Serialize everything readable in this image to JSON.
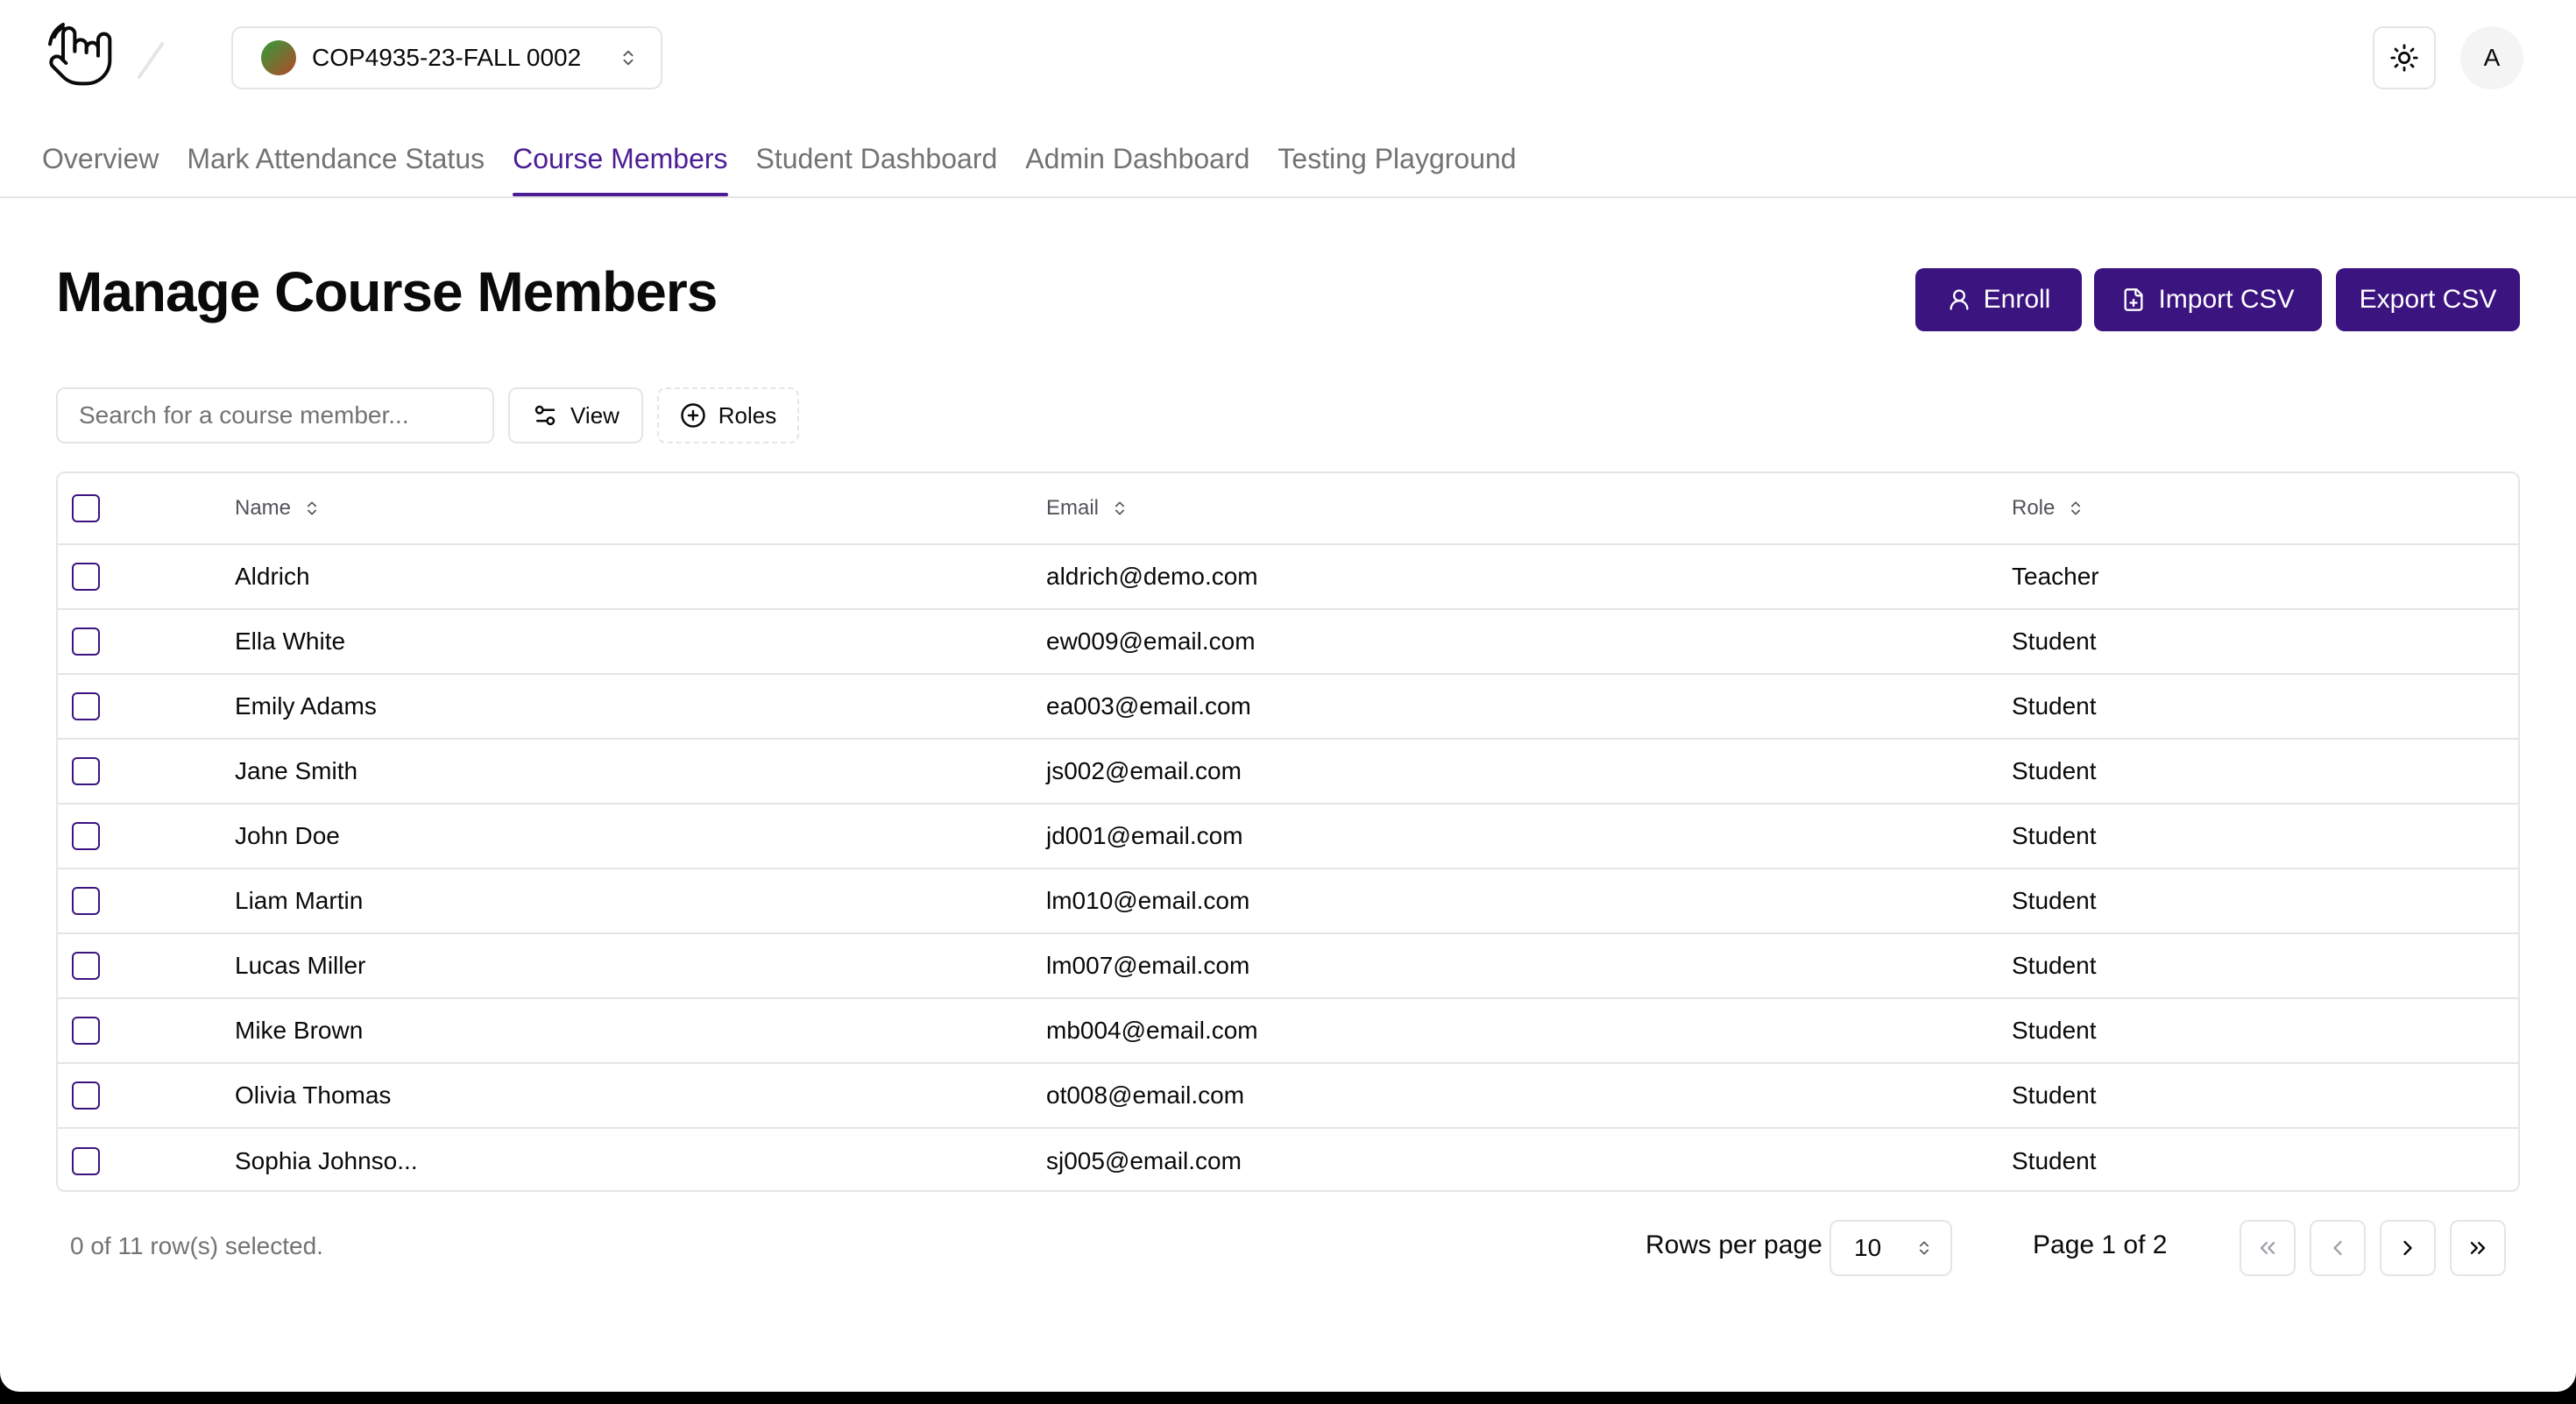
{
  "header": {
    "course_name": "COP4935-23-FALL 0002",
    "avatar_initial": "A"
  },
  "nav": {
    "tabs": [
      {
        "label": "Overview",
        "active": false
      },
      {
        "label": "Mark Attendance Status",
        "active": false
      },
      {
        "label": "Course Members",
        "active": true
      },
      {
        "label": "Student Dashboard",
        "active": false
      },
      {
        "label": "Admin Dashboard",
        "active": false
      },
      {
        "label": "Testing Playground",
        "active": false
      }
    ]
  },
  "main": {
    "title": "Manage Course Members",
    "actions": {
      "enroll_label": "Enroll",
      "import_label": "Import CSV",
      "export_label": "Export CSV"
    },
    "toolbar": {
      "search_placeholder": "Search for a course member...",
      "view_label": "View",
      "roles_label": "Roles"
    },
    "table": {
      "columns": [
        "Name",
        "Email",
        "Role"
      ],
      "rows": [
        {
          "name": "Aldrich",
          "email": "aldrich@demo.com",
          "role": "Teacher"
        },
        {
          "name": "Ella White",
          "email": "ew009@email.com",
          "role": "Student"
        },
        {
          "name": "Emily Adams",
          "email": "ea003@email.com",
          "role": "Student"
        },
        {
          "name": "Jane Smith",
          "email": "js002@email.com",
          "role": "Student"
        },
        {
          "name": "John Doe",
          "email": "jd001@email.com",
          "role": "Student"
        },
        {
          "name": "Liam Martin",
          "email": "lm010@email.com",
          "role": "Student"
        },
        {
          "name": "Lucas Miller",
          "email": "lm007@email.com",
          "role": "Student"
        },
        {
          "name": "Mike Brown",
          "email": "mb004@email.com",
          "role": "Student"
        },
        {
          "name": "Olivia Thomas",
          "email": "ot008@email.com",
          "role": "Student"
        },
        {
          "name": "Sophia Johnso...",
          "email": "sj005@email.com",
          "role": "Student"
        }
      ]
    },
    "footer": {
      "selection_info": "0 of 11 row(s) selected.",
      "rows_per_page_label": "Rows per page",
      "rows_per_page_value": "10",
      "page_info": "Page 1 of 2"
    }
  },
  "icons": {
    "logo": "waving-hand-icon",
    "theme": "sun-icon",
    "enroll": "user-icon",
    "import": "file-plus-icon",
    "view": "sliders-icon",
    "roles": "plus-circle-icon",
    "sort": "chevrons-up-down-icon",
    "first_page": "chevrons-left-icon",
    "prev_page": "chevron-left-icon",
    "next_page": "chevron-right-icon",
    "last_page": "chevrons-right-icon"
  },
  "colors": {
    "primary": "#3b1480",
    "active_tab": "#4c1d95",
    "border": "#e5e5e5",
    "muted_text": "#737373"
  }
}
